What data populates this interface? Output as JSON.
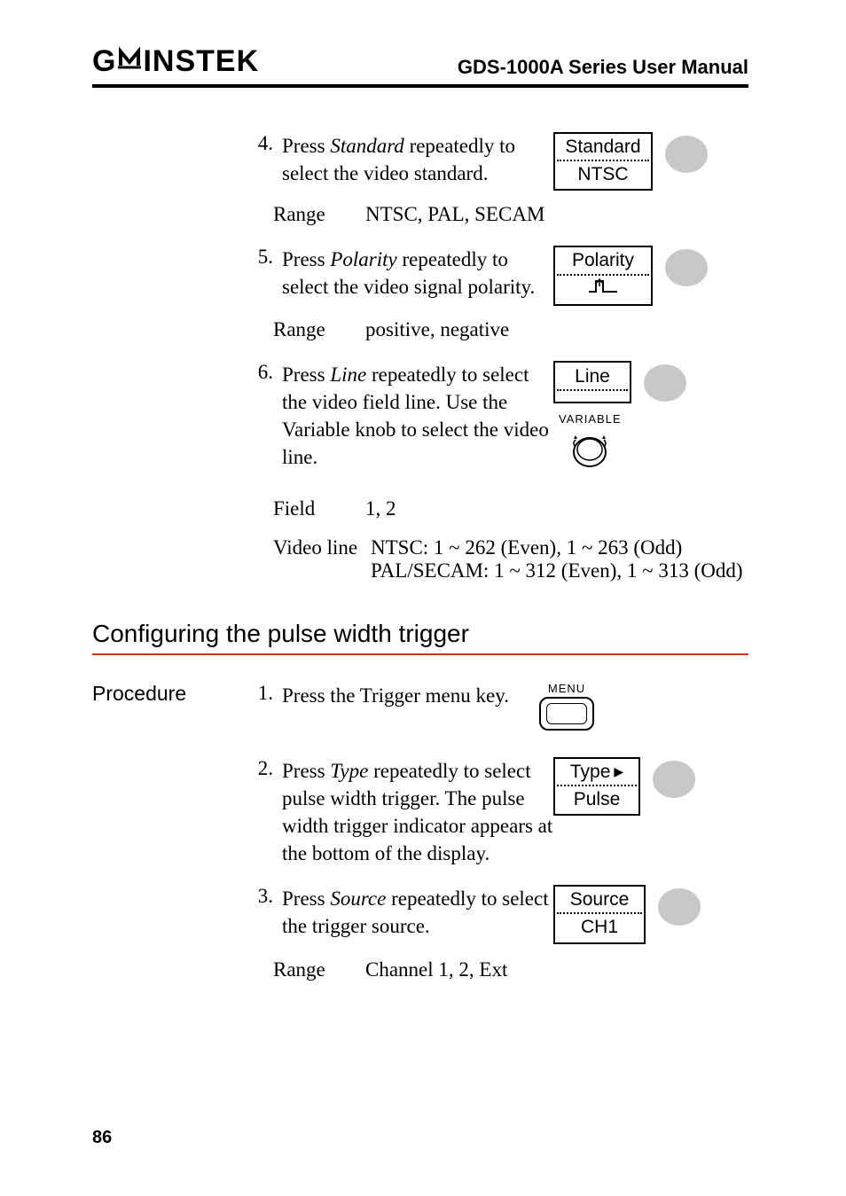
{
  "header": {
    "brand_left": "G",
    "brand_w": "W",
    "brand_right": "INSTEK",
    "title": "GDS-1000A Series User Manual"
  },
  "steps_a": [
    {
      "num": "4.",
      "text_pre": "Press ",
      "text_em": "Standard",
      "text_post": " repeatedly to select the video standard.",
      "softkey_top": "Standard",
      "softkey_bot": "NTSC",
      "range_label": "Range",
      "range_value": "NTSC, PAL, SECAM"
    },
    {
      "num": "5.",
      "text_pre": "Press ",
      "text_em": "Polarity",
      "text_post": " repeatedly to select the video signal polarity.",
      "softkey_top": "Polarity",
      "polarity_icon": true,
      "range_label": "Range",
      "range_value": "positive, negative"
    },
    {
      "num": "6.",
      "text_pre": "Press ",
      "text_em": "Line",
      "text_post": " repeatedly to select the video field line. Use the Variable knob to select the video line.",
      "softkey_top": "Line",
      "variable_label": "VARIABLE",
      "field_label": "Field",
      "field_value": "1, 2",
      "videoline_label": "Video line",
      "videoline_value": "NTSC: 1 ~ 262 (Even), 1 ~ 263 (Odd) PAL/SECAM: 1 ~ 312 (Even), 1 ~ 313 (Odd)"
    }
  ],
  "section_title": "Configuring the pulse width trigger",
  "procedure_label": "Procedure",
  "steps_b": [
    {
      "num": "1.",
      "text": "Press the Trigger menu key.",
      "menu_label": "MENU"
    },
    {
      "num": "2.",
      "text_pre": "Press ",
      "text_em": "Type",
      "text_post": " repeatedly to select pulse width trigger. The pulse width trigger indicator appears at the bottom of the display.",
      "softkey_top": "Type",
      "softkey_bot": "Pulse"
    },
    {
      "num": "3.",
      "text_pre": "Press ",
      "text_em": "Source",
      "text_post": " repeatedly to select the trigger source.",
      "softkey_top": "Source",
      "softkey_bot": "CH1",
      "range_label": "Range",
      "range_value": "Channel 1, 2, Ext"
    }
  ],
  "page_number": "86"
}
